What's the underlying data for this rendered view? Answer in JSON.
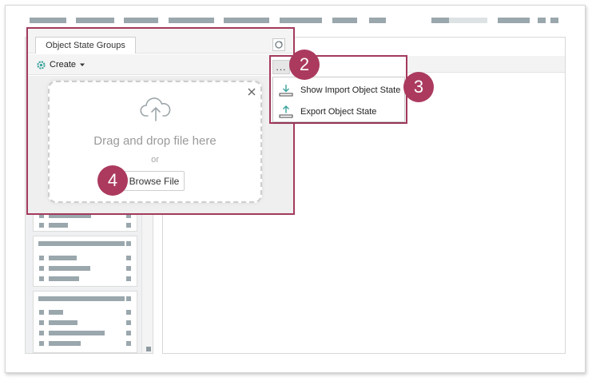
{
  "panel": {
    "tab_label": "Object State Groups",
    "create_label": "Create"
  },
  "dropzone": {
    "main_text": "Drag and drop file here",
    "or_text": "or",
    "browse_label": "Browse File"
  },
  "menu": {
    "ellipsis_label": "...",
    "items": [
      {
        "label": "Show Import Object State",
        "icon": "download-icon"
      },
      {
        "label": "Export Object State",
        "icon": "upload-icon"
      }
    ]
  },
  "callouts": [
    "2",
    "3",
    "4"
  ],
  "colors": {
    "accent_border": "#a33a5c",
    "callout_fill": "#ab3a5e",
    "icon_teal": "#3aa39b",
    "placeholder_gray": "#9aa7ad"
  }
}
